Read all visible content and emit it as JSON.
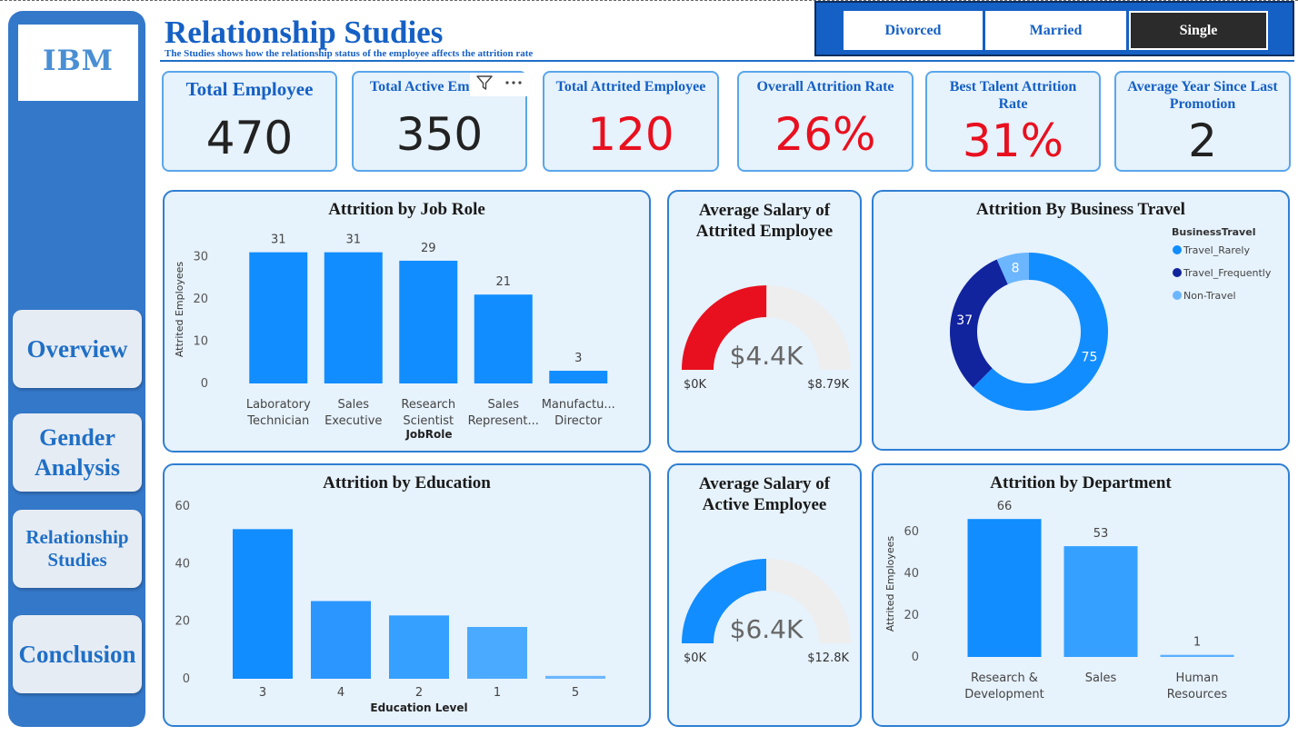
{
  "page": {
    "title": "Relationship Studies",
    "subtitle": "The Studies shows how the relationship status of the employee affects the attrition rate"
  },
  "colors": {
    "sidebar": "#3478c9",
    "title": "#1560c4",
    "bar_primary": "#118dff",
    "bar_secondary": "#41a4ff",
    "red": "#e8101f",
    "dark_navy": "#12239e",
    "light_blue": "#6bb6ff",
    "gauge_track": "#eeeeee"
  },
  "sidebar": {
    "logo": "IBM",
    "nav": [
      {
        "label": "Overview"
      },
      {
        "label": "Gender Analysis"
      },
      {
        "label": "Relationship Studies"
      },
      {
        "label": "Conclusion"
      }
    ]
  },
  "slicer": {
    "options": [
      "Divorced",
      "Married",
      "Single"
    ],
    "selected": "Single"
  },
  "kpis": [
    {
      "label": "Total Employee",
      "value": "470",
      "color": "#222222"
    },
    {
      "label": "Total Active Employee",
      "value": "350",
      "color": "#222222"
    },
    {
      "label": "Total Attrited Employee",
      "value": "120",
      "color": "#e8101f"
    },
    {
      "label": "Overall Attrition Rate",
      "value": "26%",
      "color": "#e8101f"
    },
    {
      "label": "Best Talent Attrition Rate",
      "value": "31%",
      "color": "#e8101f"
    },
    {
      "label": "Average Year Since Last Promotion",
      "value": "2",
      "color": "#222222"
    }
  ],
  "visual_header_icons": [
    "filter-icon",
    "more-options-icon"
  ],
  "chart_data": [
    {
      "id": "job_role",
      "type": "bar",
      "title": "Attrition by Job Role",
      "xlabel": "JobRole",
      "ylabel": "Attrited Employees",
      "categories": [
        [
          "Laboratory",
          "Technician"
        ],
        [
          "Sales",
          "Executive"
        ],
        [
          "Research",
          "Scientist"
        ],
        [
          "Sales",
          "Represent..."
        ],
        [
          "Manufactu...",
          "Director"
        ]
      ],
      "values": [
        31,
        31,
        29,
        21,
        3
      ],
      "yticks": [
        0,
        10,
        20,
        30
      ],
      "ylim": [
        0,
        35
      ],
      "data_labels": true,
      "color": "#118dff"
    },
    {
      "id": "salary_attrited",
      "type": "gauge",
      "title": "Average Salary of Attrited Employee",
      "value": 4.4,
      "min": 0,
      "max": 8.79,
      "value_label": "$4.4K",
      "min_label": "$0K",
      "max_label": "$8.79K",
      "color": "#e8101f"
    },
    {
      "id": "business_travel",
      "type": "pie",
      "title": "Attrition By Business Travel",
      "legend_title": "BusinessTravel",
      "legend_position": "top-right",
      "slices": [
        {
          "name": "Travel_Rarely",
          "value": 75,
          "color": "#118dff"
        },
        {
          "name": "Travel_Frequently",
          "value": 37,
          "color": "#12239e"
        },
        {
          "name": "Non-Travel",
          "value": 8,
          "color": "#6bb6ff"
        }
      ]
    },
    {
      "id": "education",
      "type": "bar",
      "title": "Attrition by Education",
      "xlabel": "Education Level",
      "ylabel": "",
      "categories": [
        "3",
        "4",
        "2",
        "1",
        "5"
      ],
      "values": [
        52,
        27,
        22,
        18,
        1
      ],
      "yticks": [
        0,
        20,
        40,
        60
      ],
      "ylim": [
        0,
        60
      ],
      "data_labels": false,
      "colors": [
        "#118dff",
        "#2b96ff",
        "#35a0ff",
        "#4aaaff",
        "#6bb6ff"
      ]
    },
    {
      "id": "salary_active",
      "type": "gauge",
      "title": "Average Salary of Active Employee",
      "value": 6.4,
      "min": 0,
      "max": 12.8,
      "value_label": "$6.4K",
      "min_label": "$0K",
      "max_label": "$12.8K",
      "color": "#118dff"
    },
    {
      "id": "department",
      "type": "bar",
      "title": "Attrition by Department",
      "xlabel": "",
      "ylabel": "Attrited Employees",
      "categories": [
        [
          "Research &",
          "Development"
        ],
        [
          "Sales"
        ],
        [
          "Human",
          "Resources"
        ]
      ],
      "values": [
        66,
        53,
        1
      ],
      "yticks": [
        0,
        20,
        40,
        60
      ],
      "ylim": [
        0,
        70
      ],
      "data_labels": true,
      "colors": [
        "#118dff",
        "#35a0ff",
        "#5aafff"
      ]
    }
  ]
}
